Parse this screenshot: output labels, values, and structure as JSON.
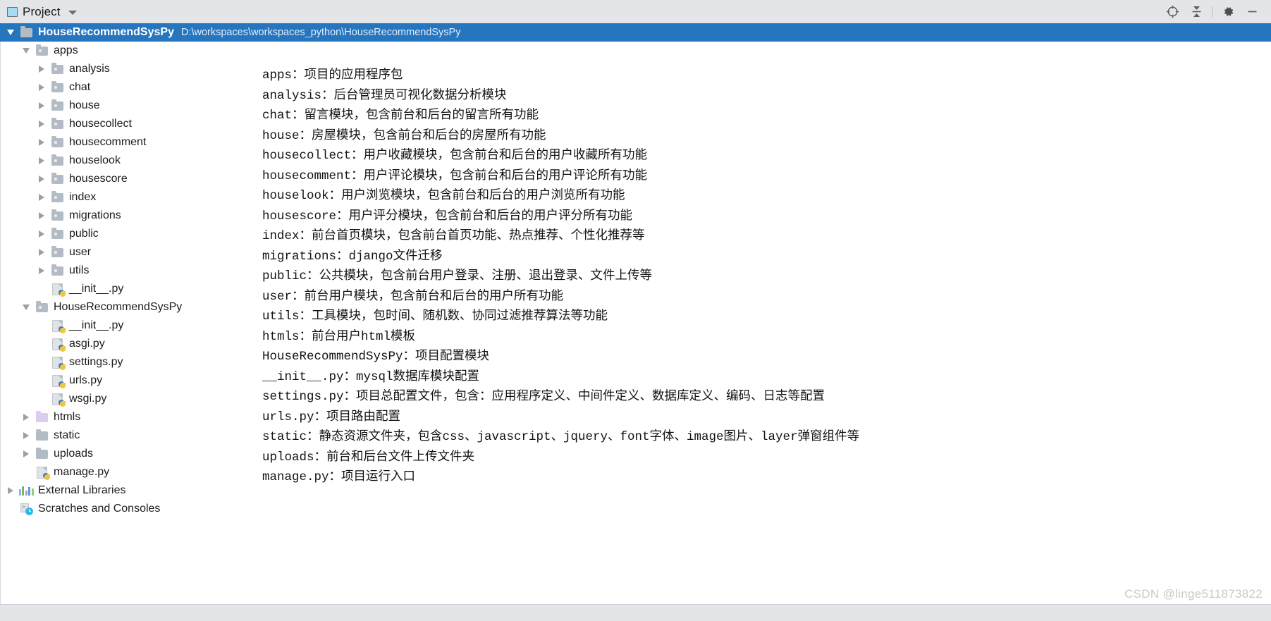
{
  "header": {
    "title": "Project",
    "project_icon": "project-icon",
    "dropdown_icon": "chevron-down-icon",
    "actions": [
      {
        "name": "locate-icon",
        "tip": "Select Opened File"
      },
      {
        "name": "collapse-all-icon",
        "tip": "Collapse All"
      },
      {
        "name": "gear-icon",
        "tip": "Settings"
      },
      {
        "name": "minimize-icon",
        "tip": "Hide"
      }
    ]
  },
  "tree": {
    "root": {
      "label": "HouseRecommendSysPy",
      "path": "D:\\workspaces\\workspaces_python\\HouseRecommendSysPy",
      "expanded": true,
      "selected": true,
      "icon": "folder-icon"
    },
    "items": [
      {
        "label": "apps",
        "depth": 1,
        "twisty": "down",
        "icon": "folder-package-icon"
      },
      {
        "label": "analysis",
        "depth": 2,
        "twisty": "right",
        "icon": "folder-package-icon"
      },
      {
        "label": "chat",
        "depth": 2,
        "twisty": "right",
        "icon": "folder-package-icon"
      },
      {
        "label": "house",
        "depth": 2,
        "twisty": "right",
        "icon": "folder-package-icon"
      },
      {
        "label": "housecollect",
        "depth": 2,
        "twisty": "right",
        "icon": "folder-package-icon"
      },
      {
        "label": "housecomment",
        "depth": 2,
        "twisty": "right",
        "icon": "folder-package-icon"
      },
      {
        "label": "houselook",
        "depth": 2,
        "twisty": "right",
        "icon": "folder-package-icon"
      },
      {
        "label": "housescore",
        "depth": 2,
        "twisty": "right",
        "icon": "folder-package-icon"
      },
      {
        "label": "index",
        "depth": 2,
        "twisty": "right",
        "icon": "folder-package-icon"
      },
      {
        "label": "migrations",
        "depth": 2,
        "twisty": "right",
        "icon": "folder-package-icon"
      },
      {
        "label": "public",
        "depth": 2,
        "twisty": "right",
        "icon": "folder-package-icon"
      },
      {
        "label": "user",
        "depth": 2,
        "twisty": "right",
        "icon": "folder-package-icon"
      },
      {
        "label": "utils",
        "depth": 2,
        "twisty": "right",
        "icon": "folder-package-icon"
      },
      {
        "label": "__init__.py",
        "depth": 2,
        "twisty": "none",
        "icon": "python-file-icon"
      },
      {
        "label": "HouseRecommendSysPy",
        "depth": 1,
        "twisty": "down",
        "icon": "folder-package-icon"
      },
      {
        "label": "__init__.py",
        "depth": 2,
        "twisty": "none",
        "icon": "python-file-icon"
      },
      {
        "label": "asgi.py",
        "depth": 2,
        "twisty": "none",
        "icon": "python-file-icon"
      },
      {
        "label": "settings.py",
        "depth": 2,
        "twisty": "none",
        "icon": "python-file-icon"
      },
      {
        "label": "urls.py",
        "depth": 2,
        "twisty": "none",
        "icon": "python-file-icon"
      },
      {
        "label": "wsgi.py",
        "depth": 2,
        "twisty": "none",
        "icon": "python-file-icon"
      },
      {
        "label": "htmls",
        "depth": 1,
        "twisty": "right",
        "icon": "folder-template-icon"
      },
      {
        "label": "static",
        "depth": 1,
        "twisty": "right",
        "icon": "folder-icon"
      },
      {
        "label": "uploads",
        "depth": 1,
        "twisty": "right",
        "icon": "folder-icon"
      },
      {
        "label": "manage.py",
        "depth": 1,
        "twisty": "none",
        "icon": "python-file-icon"
      },
      {
        "label": "External Libraries",
        "depth": 0,
        "twisty": "right",
        "icon": "libraries-icon"
      },
      {
        "label": "Scratches and Consoles",
        "depth": 0,
        "twisty": "none",
        "icon": "scratches-icon"
      }
    ]
  },
  "doc": {
    "lines": [
      "apps：项目的应用程序包",
      "analysis：后台管理员可视化数据分析模块",
      "chat：留言模块，包含前台和后台的留言所有功能",
      "house：房屋模块，包含前台和后台的房屋所有功能",
      "housecollect：用户收藏模块，包含前台和后台的用户收藏所有功能",
      "housecomment：用户评论模块，包含前台和后台的用户评论所有功能",
      "houselook：用户浏览模块，包含前台和后台的用户浏览所有功能",
      "housescore：用户评分模块，包含前台和后台的用户评分所有功能",
      "index：前台首页模块，包含前台首页功能、热点推荐、个性化推荐等",
      "migrations：django文件迁移",
      "public：公共模块，包含前台用户登录、注册、退出登录、文件上传等",
      "user：前台用户模块，包含前台和后台的用户所有功能",
      "utils：工具模块，包时间、随机数、协同过滤推荐算法等功能",
      "htmls：前台用户html模板",
      "HouseRecommendSysPy：项目配置模块",
      "__init__.py：mysql数据库模块配置",
      "settings.py：项目总配置文件，包含：应用程序定义、中间件定义、数据库定义、编码、日志等配置",
      "urls.py：项目路由配置",
      "static：静态资源文件夹，包含css、javascript、jquery、font字体、image图片、layer弹窗组件等",
      "uploads：前台和后台文件上传文件夹",
      "manage.py：项目运行入口"
    ]
  },
  "watermark": {
    "text": "CSDN @linge511873822"
  },
  "colors": {
    "selection": "#2675bf",
    "header_bg": "#e3e5e8",
    "folder": "#b3bcc4",
    "folder_template": "#dccdf0",
    "python_blue": "#3f7fb5",
    "python_yellow": "#f2c53d",
    "accent_cyan": "#34b6e4"
  },
  "libraries_icon_bars": [
    "#8fb4d9",
    "#79b36b",
    "#a8a8a8",
    "#5a9bd5",
    "#9ccb7a"
  ]
}
